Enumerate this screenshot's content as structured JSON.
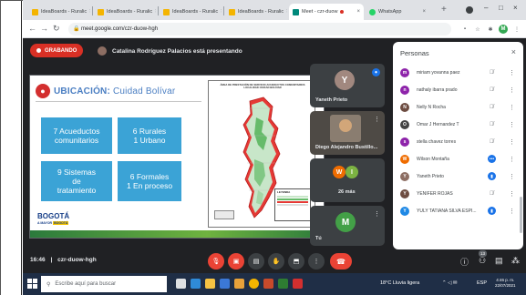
{
  "browser": {
    "tabs": [
      {
        "label": "IdeaBoards - Ruralic",
        "fav_color": "#f4b400"
      },
      {
        "label": "IdeaBoards - Ruralic",
        "fav_color": "#f4b400"
      },
      {
        "label": "IdeaBoards - Ruralic",
        "fav_color": "#f4b400"
      },
      {
        "label": "IdeaBoards - Ruralic",
        "fav_color": "#f4b400"
      },
      {
        "label": "Meet - czr-duow",
        "fav_color": "#00897b"
      },
      {
        "label": "WhatsApp",
        "fav_color": "#25d366"
      }
    ],
    "close_glyph": "×",
    "newtab_glyph": "+",
    "url": "meet.google.com/czr-duow-hgh",
    "window_controls": [
      "–",
      "□",
      "×"
    ]
  },
  "meet": {
    "recording_label": "GRABANDO",
    "presenter_label": "Catalina Rodríguez Palacios está presentando",
    "meeting_time": "16:46",
    "meeting_code": "czr-duow-hgh",
    "raised_count": "13"
  },
  "slide": {
    "title_bold": "UBICACIÓN:",
    "title_rest": "Cuidad Bolívar",
    "boxes": [
      {
        "line1": "7 Acueductos",
        "line2": "comunitarios"
      },
      {
        "line1": "6 Rurales",
        "line2": "1 Urbano"
      },
      {
        "line1": "9 Sistemas",
        "line2": "de",
        "line3": "tratamiento"
      },
      {
        "line1": "6 Formales",
        "line2": "1 En proceso"
      }
    ],
    "brand": "BOGOTÁ",
    "brand_sub_a": "A MAYOR",
    "brand_sub_b": "BOGOTÁ",
    "map_title": "ÁREA DE PRESTACIÓN DE SERVICIO ACUEDUCTOS COMUNITARIOS LOCALIDAD CIUDAD BOLÍVAR",
    "legend_title": "LEYENDA"
  },
  "tiles": [
    {
      "name": "Yaneth Prieto",
      "initial": "Y",
      "color": "#a1887f"
    },
    {
      "name": "Diego Alejandro Bustillo...",
      "initial": ""
    },
    {
      "name": "26 más",
      "initials": [
        "W",
        "I"
      ]
    },
    {
      "name": "Tú",
      "initial": "M",
      "color": "#43a047"
    }
  ],
  "panel": {
    "title": "Personas",
    "close_glyph": "×",
    "people": [
      {
        "name": "miriam yovanna paez",
        "initial": "m",
        "color": "#8e24aa",
        "mic": "muted"
      },
      {
        "name": "nathaly ibarra prado",
        "initial": "n",
        "color": "#8e24aa",
        "mic": "muted"
      },
      {
        "name": "Nelly N Rocha",
        "initial": "N",
        "color": "#6d4c41",
        "mic": "muted"
      },
      {
        "name": "Omar J Hernandez T",
        "initial": "O",
        "color": "#424242",
        "mic": "muted"
      },
      {
        "name": "stella chavez torres",
        "initial": "s",
        "color": "#8e24aa",
        "mic": "muted"
      },
      {
        "name": "Wilson Montaña",
        "initial": "W",
        "color": "#ef6c00",
        "mic": "active"
      },
      {
        "name": "Yaneth Prieto",
        "initial": "Y",
        "color": "#8d6e63",
        "mic": "active"
      },
      {
        "name": "YENIFER ROJAS",
        "initial": "Y",
        "color": "#6d4c41",
        "mic": "muted"
      },
      {
        "name": "YULY TATIANA SILVA ESPI...",
        "initial": "Y",
        "color": "#1e88e5",
        "mic": "active"
      }
    ]
  },
  "taskbar": {
    "search_placeholder": "Escribe aquí para buscar",
    "weather": "18°C Lluvia ligera",
    "lang": "ESP",
    "time": "4:46 p. m.",
    "date": "22/07/2021"
  },
  "colors": {
    "meet_bg": "#202124",
    "record_red": "#d93025",
    "slide_blue": "#3ba3d6",
    "accent_blue": "#1a73e8"
  }
}
